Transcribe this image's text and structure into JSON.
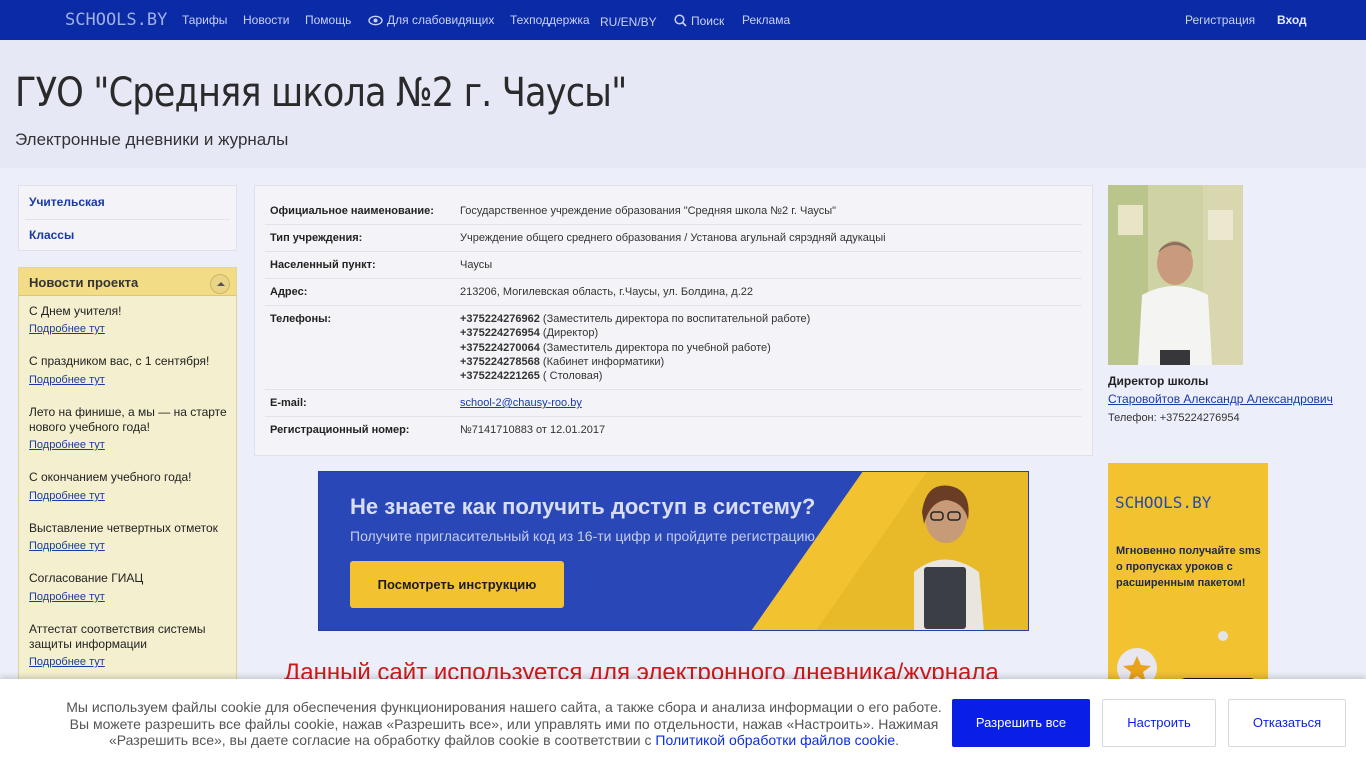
{
  "topbar": {
    "logo": "SCHOOLS.BY",
    "nav": [
      "Тарифы",
      "Новости",
      "Помощь",
      "Для слабовидящих",
      "Техподдержка",
      "RU/EN/BY",
      "Поиск",
      "Реклама"
    ],
    "register": "Регистрация",
    "login": "Вход"
  },
  "header": {
    "title": "ГУО \"Средняя школа №2 г. Чаусы\"",
    "subtitle": "Электронные дневники и журналы"
  },
  "menu": [
    "Учительская",
    "Классы"
  ],
  "news": {
    "title": "Новости проекта",
    "more_label": "Подробнее тут",
    "items": [
      "С Днем учителя!",
      "С праздником вас, с 1 сентября!",
      "Лето на финише, а мы — на старте нового учебного года!",
      "С окончанием учебного года!",
      "Выставление четвертных отметок",
      "Согласование ГИАЦ",
      "Аттестат соответствия системы защиты информации"
    ]
  },
  "info": {
    "official_label": "Официальное наименование:",
    "official_value": "Государственное учреждение образования \"Средняя школа №2 г. Чаусы\"",
    "type_label": "Тип учреждения:",
    "type_value": "Учреждение общего среднего образования / Установа агульнай сярэдняй адукацыі",
    "city_label": "Населенный пункт:",
    "city_value": "Чаусы",
    "address_label": "Адрес:",
    "address_value": "213206, Могилевская область, г.Чаусы, ул. Болдина, д.22",
    "phones_label": "Телефоны:",
    "phones": [
      {
        "num": "+375224276962",
        "desc": " (Заместитель директора по воспитательной работе)"
      },
      {
        "num": "+375224276954",
        "desc": " (Директор)"
      },
      {
        "num": "+375224270064",
        "desc": " (Заместитель директора по учебной работе)"
      },
      {
        "num": "+375224278568",
        "desc": " (Кабинет информатики)"
      },
      {
        "num": "+375224221265",
        "desc": " ( Столовая)"
      }
    ],
    "email_label": "E-mail:",
    "email_value": "school-2@chausy-roo.by",
    "reg_label": "Регистрационный номер:",
    "reg_value": "№7141710883 от 12.01.2017"
  },
  "banner": {
    "title": "Не знаете как получить доступ в систему?",
    "text": "Получите пригласительный код из 16-ти цифр и пройдите регистрацию",
    "button": "Посмотреть инструкцию"
  },
  "notice": "Данный сайт используется для электронного дневника/журнала",
  "director": {
    "title": "Директор школы",
    "name": "Старовойтов Александр Александрович",
    "phone": "Телефон: +375224276954"
  },
  "ad": {
    "logo": "SCHOOLS.BY",
    "text": "Мгновенно получайте sms о пропусках уроков с расширенным пакетом!"
  },
  "cookie": {
    "text": "Мы используем файлы cookie для обеспечения функционирования нашего сайта, а также сбора и анализа информации о его работе. Вы можете разрешить все файлы cookie, нажав «Разрешить все», или управлять ими по отдельности, нажав «Настроить». Нажимая «Разрешить все», вы даете согласие на обработку файлов cookie в соответствии с ",
    "link": "Политикой обработки файлов cookie",
    "tail": ".",
    "allow": "Разрешить все",
    "configure": "Настроить",
    "decline": "Отказаться"
  }
}
